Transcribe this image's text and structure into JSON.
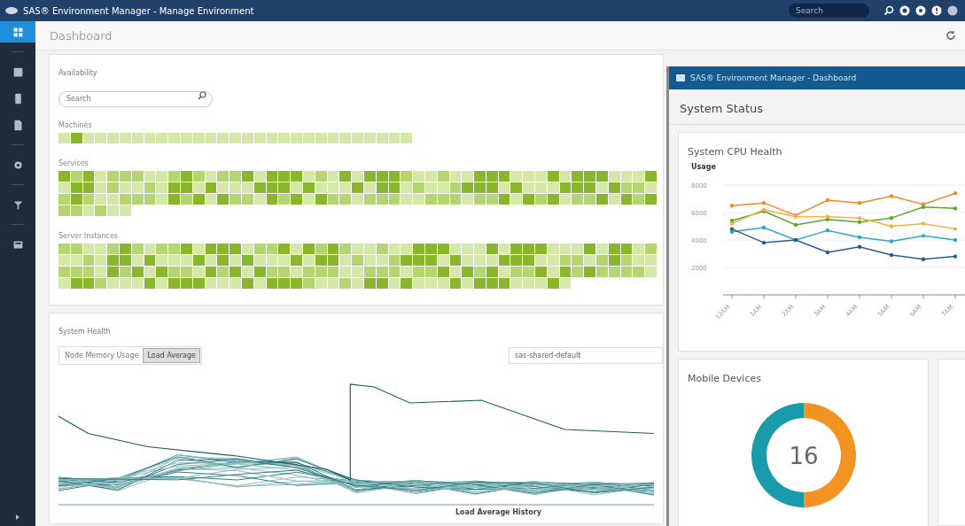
{
  "window": {
    "title": "SAS® Environment Manager - Manage Environment"
  },
  "top_bar": {
    "search": {
      "placeholder": "Search"
    }
  },
  "sidebar": {
    "items": [
      {
        "selected": true
      },
      {
        "selected": false
      },
      {
        "selected": false
      },
      {
        "selected": false
      },
      {
        "selected": false
      },
      {
        "selected": false
      },
      {
        "selected": false
      }
    ]
  },
  "page": {
    "title": "Dashboard"
  },
  "availability": {
    "title": "Availability",
    "search": {
      "placeholder": "Search"
    },
    "groups": [
      {
        "label": "Machines"
      },
      {
        "label": "Services"
      },
      {
        "label": "Server Instances"
      }
    ]
  },
  "system_health": {
    "title": "System Health",
    "toggles": [
      {
        "label": "Node Memory Usage",
        "selected": false
      },
      {
        "label": "Load Average",
        "selected": true
      }
    ],
    "dropdown": {
      "value": "sas-shared-default"
    },
    "chart_caption": "Load Average History"
  },
  "dashboard_window": {
    "title": "SAS® Environment Manager - Dashboard",
    "heading": "System Status",
    "cpu_card": {
      "title": "System CPU Health",
      "chart_data": {
        "type": "line",
        "ylabel": "Usage",
        "categories": [
          "12AM",
          "1AM",
          "2AM",
          "3AM",
          "4AM",
          "5AM",
          "6AM",
          "7AM"
        ],
        "grid": true,
        "ylim": [
          0,
          8000
        ],
        "yticks": [
          2000,
          4000,
          6000,
          8000
        ],
        "series": [
          {
            "color": "#f08a2c",
            "values": [
              6500,
              6700,
              5800,
              6900,
              6700,
              7200,
              6600,
              7400
            ]
          },
          {
            "color": "#5aa832",
            "values": [
              5400,
              6100,
              5100,
              5500,
              5300,
              5600,
              6400,
              6300
            ]
          },
          {
            "color": "#f5b04a",
            "values": [
              5200,
              6200,
              5700,
              5700,
              5600,
              5000,
              5200,
              4800
            ]
          },
          {
            "color": "#29a8c8",
            "values": [
              4600,
              4900,
              4000,
              4700,
              4200,
              3900,
              4300,
              4000
            ]
          },
          {
            "color": "#2a5a8c",
            "values": [
              4800,
              3800,
              4000,
              3100,
              3500,
              2900,
              2600,
              2800
            ]
          }
        ]
      }
    },
    "mobile_card": {
      "title": "Mobile Devices",
      "total": "16",
      "chart_data": {
        "type": "donut",
        "values": [
          50,
          50
        ],
        "colors": [
          "#1a9bab",
          "#f39322"
        ]
      }
    }
  }
}
